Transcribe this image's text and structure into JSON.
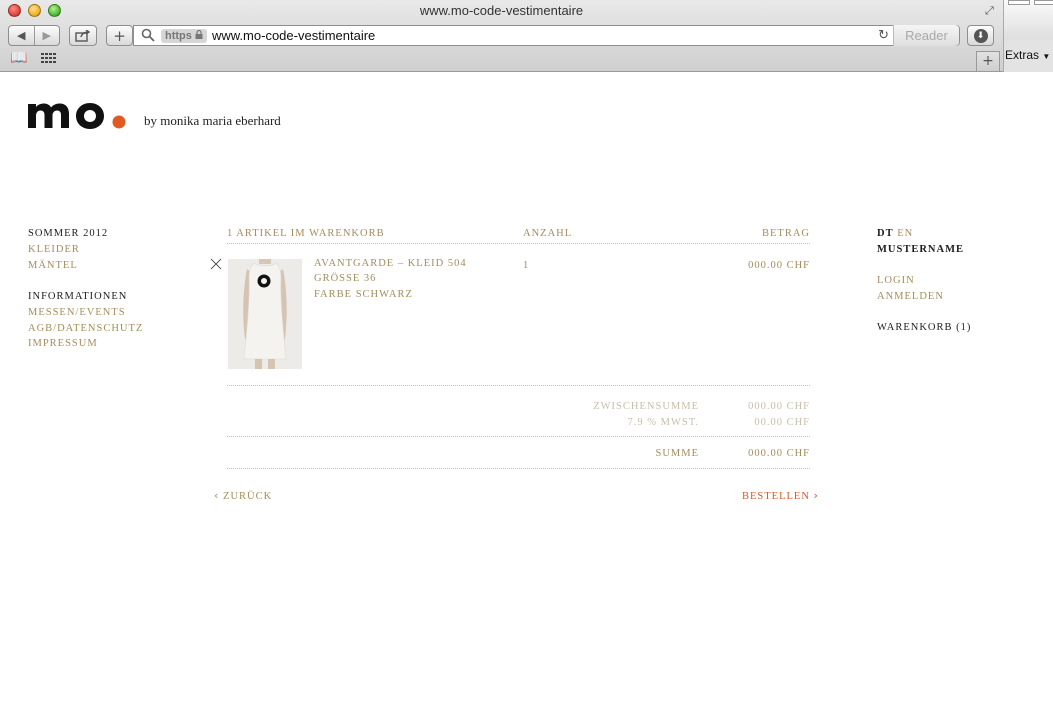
{
  "browser": {
    "window_title": "www.mo-code-vestimentaire",
    "url_scheme": "https",
    "url": "www.mo-code-vestimentaire",
    "reader_label": "Reader",
    "extras_label": "Extras"
  },
  "site": {
    "logo_text": "mo",
    "tagline": "by monika maria eberhard",
    "brand_color": "#e05a22"
  },
  "nav": {
    "collection_title": "SOMMER 2012",
    "collection_items": [
      "KLEIDER",
      "MÄNTEL"
    ],
    "info_title": "INFORMATIONEN",
    "info_items": [
      "MESSEN/EVENTS",
      "AGB/DATENSCHUTZ",
      "IMPRESSUM"
    ]
  },
  "cart": {
    "header_items": "1 ARTIKEL IM WARENKORB",
    "header_qty": "ANZAHL",
    "header_amount": "BETRAG",
    "item": {
      "name": "AVANTGARDE – KLEID 504",
      "size": "GRÖSSE 36",
      "color": "FARBE SCHWARZ",
      "quantity": "1",
      "price": "000.00 CHF"
    },
    "subtotal_label": "ZWISCHENSUMME",
    "subtotal_value": "000.00 CHF",
    "vat_label": "7.9 % MWST.",
    "vat_value": "00.00 CHF",
    "total_label": "SUMME",
    "total_value": "000.00 CHF",
    "back_label": "ZURÜCK",
    "order_label": "BESTELLEN"
  },
  "account": {
    "lang_active": "DT",
    "lang_other": "EN",
    "username": "MUSTERNAME",
    "login": "LOGIN",
    "register": "ANMELDEN",
    "cart_link": "WARENKORB (1)"
  }
}
